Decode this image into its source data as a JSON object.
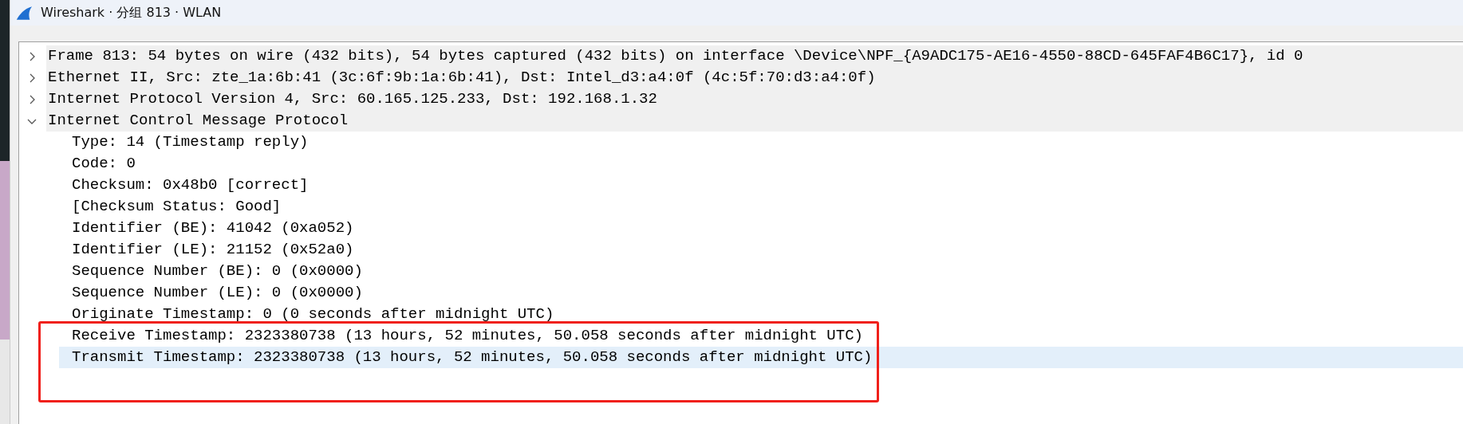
{
  "window": {
    "title": "Wireshark · 分组 813 · WLAN"
  },
  "tree": [
    {
      "text": "Frame 813: 54 bytes on wire (432 bits), 54 bytes captured (432 bits) on interface \\Device\\NPF_{A9ADC175-AE16-4550-88CD-645FAF4B6C17}, id 0",
      "expanded": false,
      "selected": false
    },
    {
      "text": "Ethernet II, Src: zte_1a:6b:41 (3c:6f:9b:1a:6b:41), Dst: Intel_d3:a4:0f (4c:5f:70:d3:a4:0f)",
      "expanded": false,
      "selected": false
    },
    {
      "text": "Internet Protocol Version 4, Src: 60.165.125.233, Dst: 192.168.1.32",
      "expanded": false,
      "selected": false
    },
    {
      "text": "Internet Control Message Protocol",
      "expanded": true,
      "selected": false,
      "children": [
        {
          "text": "Type: 14 (Timestamp reply)",
          "selected": false
        },
        {
          "text": "Code: 0",
          "selected": false
        },
        {
          "text": "Checksum: 0x48b0 [correct]",
          "selected": false
        },
        {
          "text": "[Checksum Status: Good]",
          "selected": false
        },
        {
          "text": "Identifier (BE): 41042 (0xa052)",
          "selected": false
        },
        {
          "text": "Identifier (LE): 21152 (0x52a0)",
          "selected": false
        },
        {
          "text": "Sequence Number (BE): 0 (0x0000)",
          "selected": false
        },
        {
          "text": "Sequence Number (LE): 0 (0x0000)",
          "selected": false
        },
        {
          "text": "Originate Timestamp: 0 (0 seconds after midnight UTC)",
          "selected": false
        },
        {
          "text": "Receive Timestamp: 2323380738 (13 hours, 52 minutes, 50.058 seconds after midnight UTC)",
          "selected": false
        },
        {
          "text": "Transmit Timestamp: 2323380738 (13 hours, 52 minutes, 50.058 seconds after midnight UTC)",
          "selected": true
        }
      ]
    }
  ]
}
